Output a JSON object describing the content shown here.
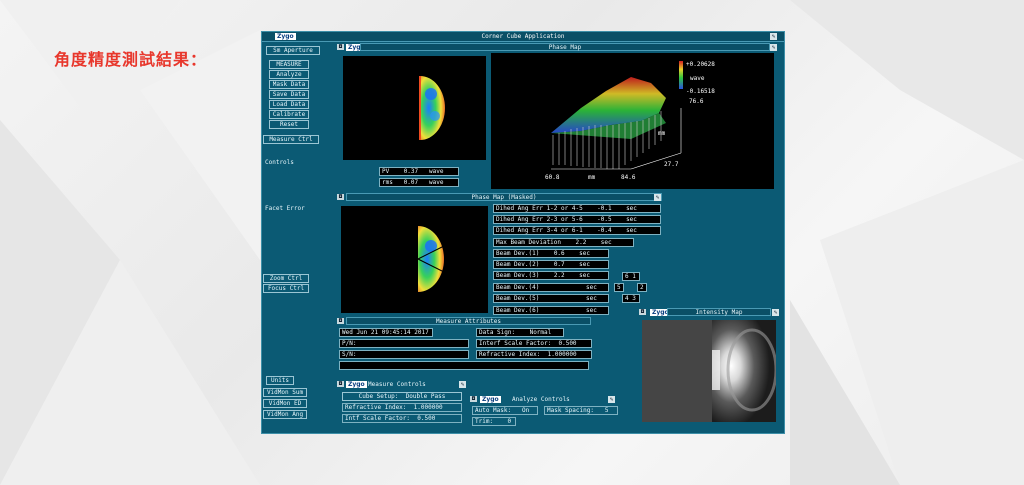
{
  "heading": "角度精度測試結果：",
  "app": {
    "title": "Corner Cube Application",
    "logo": "Zygo"
  },
  "sidebar": {
    "top_button": "Sm Aperture",
    "menu": [
      "MEASURE",
      "Analyze",
      "Mask Data",
      "Save Data",
      "Load Data",
      "Calibrate",
      "Reset"
    ],
    "items": [
      "Measure Ctrl",
      "Controls",
      "Facet Error",
      "Zoom  Ctrl",
      "Focus Ctrl"
    ],
    "bottom": [
      "Units",
      "VidMon Sum",
      "VidMon ED",
      "VidMon Ang"
    ]
  },
  "phase_map": {
    "title": "Phase Map",
    "pv_label": "PV",
    "pv_value": "0.37",
    "pv_unit": "wave",
    "rms_label": "rms",
    "rms_value": "0.07",
    "rms_unit": "wave",
    "plot": {
      "max": "+0.20628",
      "unit": "wave",
      "min": "-0.16518",
      "y_tick": "76.6",
      "y_label": "mm",
      "x_tick_right": "27.7",
      "x_left": "60.8",
      "x_label": "mm",
      "x_right": "84.6"
    }
  },
  "masked": {
    "title": "Phase Map (Masked)",
    "dihedral": [
      {
        "label": "Dihed Ang Err 1-2 or 4-5",
        "value": "-0.1",
        "unit": "sec"
      },
      {
        "label": "Dihed Ang Err 2-3 or 5-6",
        "value": "-0.5",
        "unit": "sec"
      },
      {
        "label": "Dihed Ang Err 3-4 or 6-1",
        "value": "-0.4",
        "unit": "sec"
      }
    ],
    "max_dev": {
      "label": "Max Beam Deviation",
      "value": "2.2",
      "unit": "sec"
    },
    "beam_dev": [
      {
        "label": "Beam Dev.(1)",
        "value": "0.6",
        "unit": "sec"
      },
      {
        "label": "Beam Dev.(2)",
        "value": "0.7",
        "unit": "sec"
      },
      {
        "label": "Beam Dev.(3)",
        "value": "2.2",
        "unit": "sec"
      },
      {
        "label": "Beam Dev.(4)",
        "value": "",
        "unit": "sec"
      },
      {
        "label": "Beam Dev.(5)",
        "value": "",
        "unit": "sec"
      },
      {
        "label": "Beam Dev.(6)",
        "value": "",
        "unit": "sec"
      }
    ],
    "side_labels": [
      "6 1",
      "5",
      "2",
      "4 3"
    ]
  },
  "attributes": {
    "title": "Measure Attributes",
    "date": "Wed Jun 21 09:45:14 2017",
    "pn_label": "P/N:",
    "sn_label": "S/N:",
    "data_sign_label": "Data Sign:",
    "data_sign": "Normal",
    "scale_label": "Interf Scale Factor:",
    "scale": "0.500",
    "refr_label": "Refractive Index:",
    "refr": "1.000000"
  },
  "measure_controls": {
    "title": "Measure Controls",
    "cube_setup_label": "Cube Setup:",
    "cube_setup": "Double Pass",
    "refr_label": "Refractive Index:",
    "refr": "1.000000",
    "scale_label": "Intf Scale Factor:",
    "scale": "0.500"
  },
  "analyze_controls": {
    "title": "Analyze Controls",
    "automask_label": "Auto Mask:",
    "automask": "On",
    "mask_spacing_label": "Mask Spacing:",
    "mask_spacing": "5",
    "trim_label": "Trim:",
    "trim": "0"
  },
  "intensity": {
    "title": "Intensity Map"
  },
  "colors": {
    "app_bg": "#0b5a74",
    "heading": "#e8372c"
  },
  "icons": [
    "wrench-icon",
    "close-icon"
  ]
}
